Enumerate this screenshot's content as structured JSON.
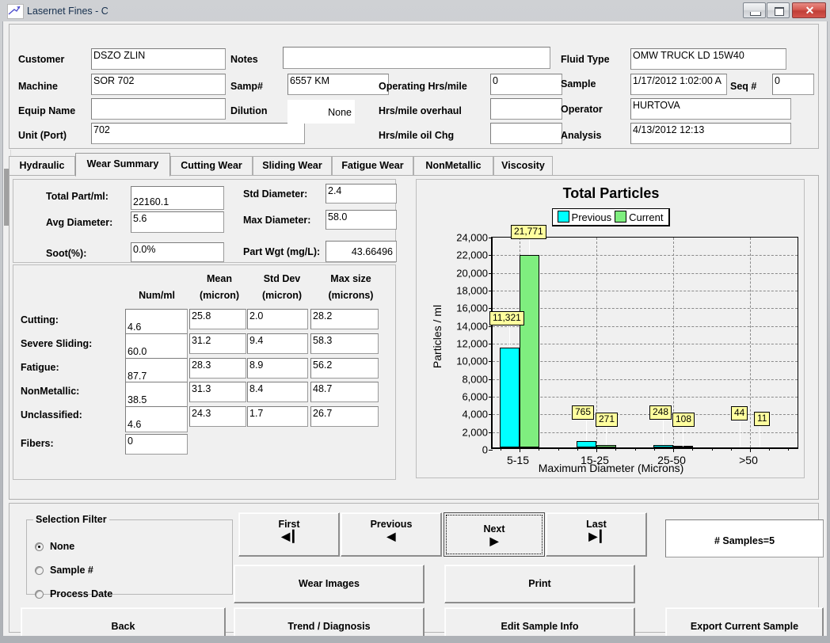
{
  "window": {
    "title": "Lasernet Fines - C",
    "icon": "chart-arrow-icon",
    "minimize_label": "–",
    "maximize_label": "□",
    "close_label": "✕"
  },
  "header": {
    "fields": [
      {
        "label": "Customer",
        "value": "DSZO ZLIN"
      },
      {
        "label": "Machine",
        "value": "SOR 702"
      },
      {
        "label": "Equip Name",
        "value": ""
      },
      {
        "label": "Unit (Port)",
        "value": "702"
      },
      {
        "label": "Notes",
        "value": ""
      },
      {
        "label": "Samp#",
        "value": "6557 KM"
      },
      {
        "label": "Dilution",
        "value": "None"
      },
      {
        "label": "Operating Hrs/mile",
        "value": "0"
      },
      {
        "label": "Hrs/mile overhaul",
        "value": ""
      },
      {
        "label": "Hrs/mile oil Chg",
        "value": ""
      },
      {
        "label": "Fluid Type",
        "value": "OMW TRUCK LD 15W40"
      },
      {
        "label": "Sample",
        "value": "1/17/2012 1:02:00 A"
      },
      {
        "label": "Seq #",
        "value": "0"
      },
      {
        "label": "Operator",
        "value": "HURTOVA"
      },
      {
        "label": "Analysis",
        "value": "4/13/2012 12:13"
      }
    ]
  },
  "tabs": [
    {
      "label": "Hydraulic",
      "active": false
    },
    {
      "label": "Wear Summary",
      "active": true
    },
    {
      "label": "Cutting Wear",
      "active": false
    },
    {
      "label": "Sliding Wear",
      "active": false
    },
    {
      "label": "Fatigue Wear",
      "active": false
    },
    {
      "label": "NonMetallic",
      "active": false
    },
    {
      "label": "Viscosity",
      "active": false
    }
  ],
  "summary": {
    "total_part_label": "Total Part/ml:",
    "total_part_value": "22160.1",
    "avg_diameter_label": "Avg Diameter:",
    "avg_diameter_value": "5.6",
    "soot_label": "Soot(%):",
    "soot_value": "0.0%",
    "std_diameter_label": "Std Diameter:",
    "std_diameter_value": "2.4",
    "max_diameter_label": "Max Diameter:",
    "max_diameter_value": "58.0",
    "part_wgt_label": "Part Wgt (mg/L):",
    "part_wgt_value": "43.66496"
  },
  "wear_table": {
    "columns": [
      {
        "line1": "Num/ml",
        "line2": ""
      },
      {
        "line1": "Mean",
        "line2": "(micron)"
      },
      {
        "line1": "Std Dev",
        "line2": "(micron)"
      },
      {
        "line1": "Max size",
        "line2": "(microns)"
      }
    ],
    "rows": [
      {
        "label": "Cutting:",
        "num": "4.6",
        "mean": "25.8",
        "std": "2.0",
        "max": "28.2"
      },
      {
        "label": "Severe Sliding:",
        "num": "60.0",
        "mean": "31.2",
        "std": "9.4",
        "max": "58.3"
      },
      {
        "label": "Fatigue:",
        "num": "87.7",
        "mean": "28.3",
        "std": "8.9",
        "max": "56.2"
      },
      {
        "label": "NonMetallic:",
        "num": "38.5",
        "mean": "31.3",
        "std": "8.4",
        "max": "48.7"
      },
      {
        "label": "Unclassified:",
        "num": "4.6",
        "mean": "24.3",
        "std": "1.7",
        "max": "26.7"
      }
    ],
    "fibers_label": "Fibers:",
    "fibers_value": "0"
  },
  "chart_data": {
    "type": "bar",
    "title": "Total Particles",
    "xlabel": "Maximum Diameter (Microns)",
    "ylabel": "Particles / ml",
    "categories": [
      "5-15",
      "15-25",
      "25-50",
      ">50"
    ],
    "ylim": [
      0,
      24000
    ],
    "ytick_step": 2000,
    "yticks": [
      "0",
      "2,000",
      "4,000",
      "6,000",
      "8,000",
      "10,000",
      "12,000",
      "14,000",
      "16,000",
      "18,000",
      "20,000",
      "22,000",
      "24,000"
    ],
    "grid": true,
    "legend_position": "top-center",
    "series": [
      {
        "name": "Previous",
        "color": "#00FFFF",
        "values": [
          11321,
          765,
          248,
          44
        ],
        "labels": [
          "11,321",
          "765",
          "248",
          "44"
        ]
      },
      {
        "name": "Current",
        "color": "#7FEE7F",
        "values": [
          21771,
          271,
          108,
          11
        ],
        "labels": [
          "21,771",
          "271",
          "108",
          "11"
        ]
      }
    ]
  },
  "selection_filter": {
    "legend": "Selection Filter",
    "options": [
      {
        "label": "None",
        "selected": true
      },
      {
        "label": "Sample #",
        "selected": false
      },
      {
        "label": "Process Date",
        "selected": false
      }
    ]
  },
  "nav_buttons": [
    {
      "label": "First",
      "glyph": "◀┃",
      "focused": false
    },
    {
      "label": "Previous",
      "glyph": "◀",
      "focused": false
    },
    {
      "label": "Next",
      "glyph": "▶",
      "focused": true
    },
    {
      "label": "Last",
      "glyph": "▶┃",
      "focused": false
    }
  ],
  "action_buttons": {
    "wear_images": "Wear Images",
    "print": "Print",
    "back": "Back",
    "trend_diagnosis": "Trend / Diagnosis",
    "edit_sample_info": "Edit Sample Info",
    "export_current_sample": "Export Current Sample"
  },
  "status": {
    "samples_count": "# Samples=5"
  },
  "colors": {
    "previous": "#00FFFF",
    "current": "#7FEE7F",
    "data_label_bg": "#FFFF9E",
    "window_face": "#F0F0F0",
    "title_text": "#17304E",
    "close_button": "#C03F38"
  }
}
